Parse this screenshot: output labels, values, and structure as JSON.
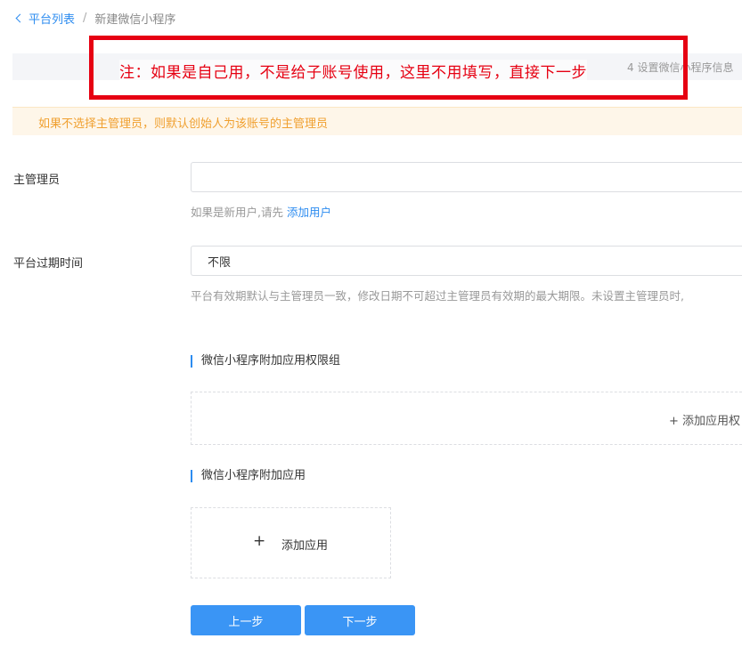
{
  "breadcrumb": {
    "parent": "平台列表",
    "separator": "/",
    "current": "新建微信小程序"
  },
  "steps": {
    "partial_text": "4  设置微信小程序信息"
  },
  "annotation": {
    "text": "注：如果是自己用，不是给子账号使用，这里不用填写，直接下一步",
    "color": "#e60012"
  },
  "alert": {
    "text": "如果不选择主管理员，则默认创始人为该账号的主管理员"
  },
  "form": {
    "admin": {
      "label": "主管理员",
      "value": "",
      "hint_prefix": "如果是新用户,请先",
      "hint_link": "添加用户"
    },
    "expire": {
      "label": "平台过期时间",
      "value": "不限",
      "hint": "平台有效期默认与主管理员一致，修改日期不可超过主管理员有效期的最大期限。未设置主管理员时,"
    }
  },
  "permission_group": {
    "title": "微信小程序附加应用权限组",
    "add_label": "+ 添加应用权"
  },
  "extra_apps": {
    "title": "微信小程序附加应用",
    "add_plus": "+",
    "add_label": "添加应用"
  },
  "buttons": {
    "prev": "上一步",
    "next": "下一步"
  },
  "colors": {
    "primary": "#2d8cf0",
    "button": "#3a95f5",
    "warning_text": "#f0a030",
    "warning_bg": "#fef6e9"
  }
}
